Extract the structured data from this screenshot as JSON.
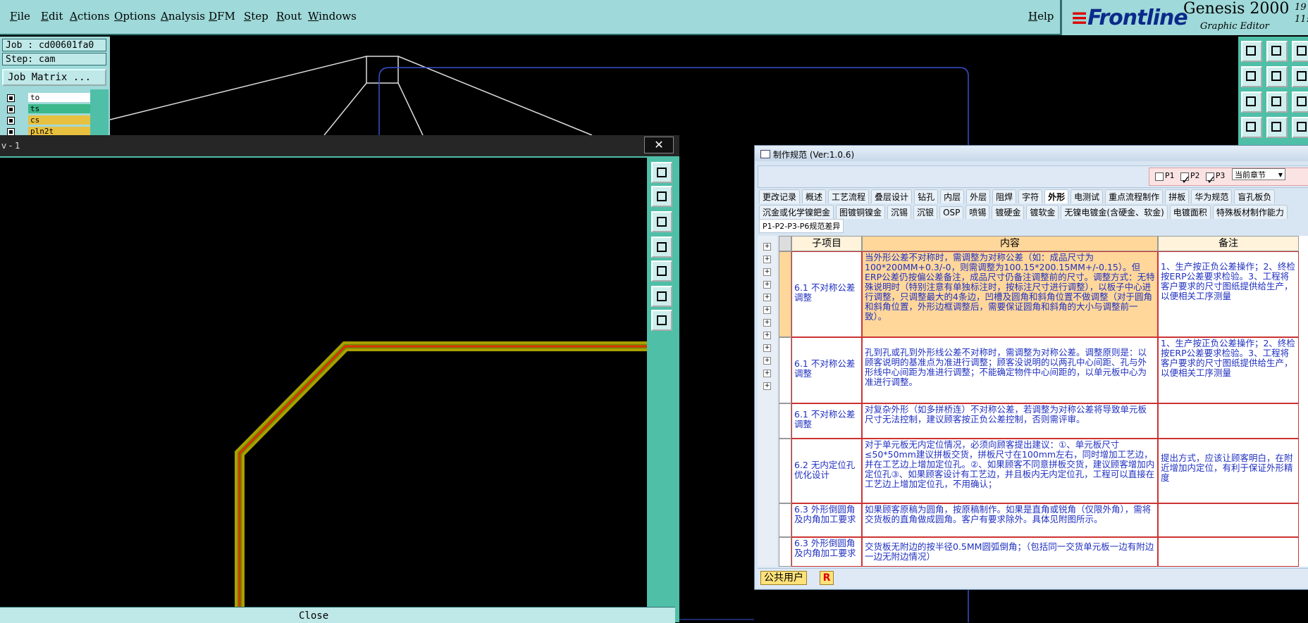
{
  "menubar": {
    "items": [
      "File",
      "Edit",
      "Actions",
      "Options",
      "Analysis",
      "DFM",
      "Step",
      "Rout",
      "Windows"
    ],
    "help": "Help"
  },
  "brand": {
    "logo": "Frontline",
    "product": "Genesis 2000",
    "subtitle": "Graphic Editor",
    "clock_line1": "19",
    "clock_line2": "11:"
  },
  "job": {
    "job_label": "Job : cd00601fa0",
    "step_label": "Step: cam",
    "matrix_button": "Job Matrix ..."
  },
  "layers": [
    {
      "name": "to",
      "color": "#ffffff"
    },
    {
      "name": "ts",
      "color": "#3cb88a"
    },
    {
      "name": "cs",
      "color": "#e8c040"
    },
    {
      "name": "pln2t",
      "color": "#e8c040"
    }
  ],
  "viewer": {
    "title": "v - 1",
    "close_label": "Close"
  },
  "spec": {
    "title": "制作规范 (Ver:1.0.6)",
    "p_labels": [
      "P1",
      "P2",
      "P3"
    ],
    "section_select": "当前章节",
    "tabs_row1": [
      "更改记录",
      "概述",
      "工艺流程",
      "叠层设计",
      "钻孔",
      "内层",
      "外层",
      "阻焊",
      "字符",
      "外形",
      "电测试",
      "重点流程制作",
      "拼板",
      "华为规范",
      "盲孔板负"
    ],
    "tabs_row2": [
      "沉金或化学镍鈀金",
      "图镀铜镍金",
      "沉锡",
      "沉银",
      "OSP",
      "喷锡",
      "镀硬金",
      "镀软金",
      "无镍电镀金(含硬金、软金)",
      "电镀面积",
      "特殊板材制作能力"
    ],
    "tab3": "P1-P2-P3-P6规范差异",
    "headers": [
      "子项目",
      "内容",
      "备注"
    ],
    "rows": [
      {
        "sub": "6.1 不对称公差调整",
        "content": "当外形公差不对称时，需调整为对称公差（如：成品尺寸为100*200MM+0.3/-0，则需调整为100.15*200.15MM+/-0.15）。但ERP公差仍按偏公差备注，成品尺寸仍备注调整前的尺寸。调整方式：无特殊说明时（特别注意有单独标注时，按标注尺寸进行调整），以板子中心进行调整，只调整最大的4条边，凹槽及圆角和斜角位置不做调整（对于圆角和斜角位置，外形边框调整后，需要保证圆角和斜角的大小与调整前一致）。",
        "note": "1、生产按正负公差操作；2、终检按ERP公差要求检验。3、工程将客户要求的尺寸图纸提供给生产，以便相关工序测量"
      },
      {
        "sub": "6.1 不对称公差调整",
        "content": "孔到孔或孔到外形线公差不对称时，需调整为对称公差。调整原则是：以顾客说明的基准点为准进行调整；顾客没说明的以两孔中心间距、孔与外形线中心间距为准进行调整；不能确定物件中心间距的，以单元板中心为准进行调整。",
        "note": "1、生产按正负公差操作；2、终检按ERP公差要求检验。3、工程将客户要求的尺寸图纸提供给生产，以便相关工序测量"
      },
      {
        "sub": "6.1 不对称公差调整",
        "content": "对复杂外形（如多拼桥连）不对称公差，若调整为对称公差将导致单元板尺寸无法控制，建议顾客按正负公差控制，否则需评审。",
        "note": ""
      },
      {
        "sub": "6.2 无内定位孔优化设计",
        "content": "对于单元板无内定位情况，必须向顾客提出建议：①、单元板尺寸≤50*50mm建议拼板交货，拼板尺寸在100mm左右，同时增加工艺边，并在工艺边上增加定位孔。②、如果顾客不同意拼板交货，建议顾客增加内定位孔③、如果顾客设计有工艺边，并且板内无内定位孔，工程可以直接在工艺边上增加定位孔，不用确认；",
        "note": "提出方式，应该让顾客明白，在附近增加内定位，有利于保证外形精度"
      },
      {
        "sub": "6.3 外形倒圆角及内角加工要求",
        "content": "如果顾客原稿为圆角，按原稿制作。如果是直角或锐角（仅限外角），需将交货板的直角做成圆角。客户有要求除外。具体见附图所示。",
        "note": ""
      },
      {
        "sub": "6.3 外形倒圆角及内角加工要求",
        "content": "交货板无附边的按半径0.5MM圆弧倒角；（包括同一交货单元板一边有附边一边无附边情况）",
        "note": ""
      }
    ],
    "footer_user": "公共用户",
    "footer_r": "R"
  },
  "colors": {
    "teal_bg": "#9fd9d9",
    "teal_dark": "#4fbfa8",
    "trace_yellow": "#a8a000",
    "trace_red": "#e03000",
    "table_text": "#2030c0"
  }
}
